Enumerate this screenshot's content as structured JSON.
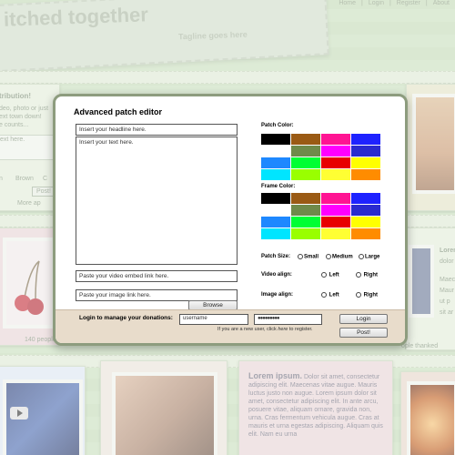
{
  "site": {
    "title": "itched together",
    "tagline": "Tagline goes here",
    "nav": [
      "Home",
      "|",
      "Login",
      "|",
      "Register",
      "|",
      "About"
    ]
  },
  "background": {
    "left_card_title": "tribution!",
    "left_card_lines": [
      "deo, photo or just",
      "ext town down!",
      "e counts..."
    ],
    "left_card_field": "ext here.",
    "radio_labels": [
      "n",
      "Brown",
      "C"
    ],
    "post_button": "Post!",
    "more_link": "More ap",
    "people_count": "140 people",
    "thanked": "ople thanked",
    "right_lorem_lines": [
      "Lorem",
      "dolor",
      "Maec",
      "Maur",
      "ut p",
      "sit ar"
    ],
    "bottom_lorem_title": "Lorem ipsum.",
    "bottom_lorem_text": "Dolor sit amet, consectetur adipiscing elit. Maecenas vitae augue. Mauris luctus justo non augue. Lorem ipsum dolor sit amet, consectetur adipiscing elit. In ante arcu, posuere vitae, aliquam ornare, gravida non, urna. Cras fermentum vehicula augue. Cras at mauris et urna egestas adipiscing. Aliquam quis elit. Nam eu urna"
  },
  "editor": {
    "title": "Advanced patch editor",
    "headline_placeholder": "Insert your headline here.",
    "text_placeholder": "Insert your text here.",
    "video_placeholder": "Paste your video embed link here.",
    "image_placeholder": "Paste your image link here.",
    "browse_label": "Browse",
    "patch_color_label": "Patch Color:",
    "frame_color_label": "Frame Color:",
    "colors": [
      "#000000",
      "#9a5a14",
      "#ff1493",
      "#1e22ff",
      "#ffffff",
      "#6f8a4a",
      "#ff00ff",
      "#2a2acf",
      "#1e88ff",
      "#00ff33",
      "#e80000",
      "#ffff00",
      "#00e5ff",
      "#99ff00",
      "#ffff33",
      "#ff8c00"
    ],
    "patch_size_label": "Patch Size:",
    "size_options": [
      "Small",
      "Medium",
      "Large"
    ],
    "video_align_label": "Video align:",
    "image_align_label": "Image align:",
    "align_options": [
      "Left",
      "Right"
    ]
  },
  "login": {
    "label": "Login to manage your donations:",
    "username_value": "username",
    "password_value": "●●●●●●●●●",
    "login_button": "Login",
    "post_button": "Post!",
    "note_prefix": "If you are a new user, click ",
    "note_link": "here",
    "note_suffix": " to register."
  }
}
